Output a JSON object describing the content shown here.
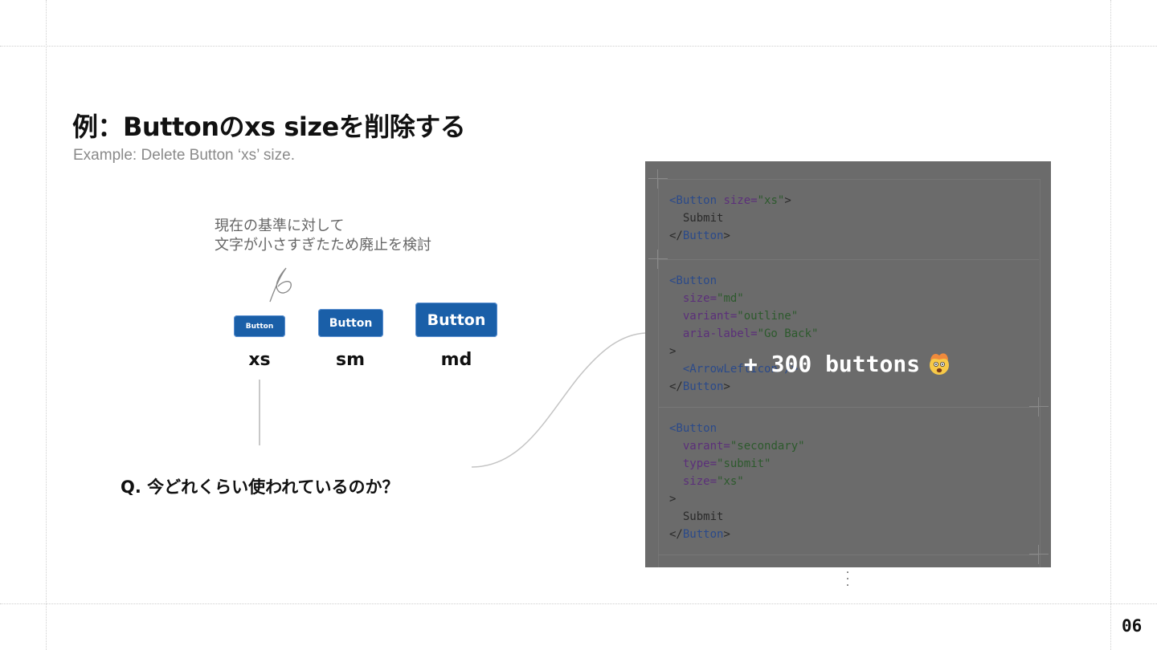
{
  "slide": {
    "title": "例：Buttonのxs sizeを削除する",
    "subtitle": "Example: Delete Button ‘xs’ size.",
    "note_line1": "現在の基準に対して",
    "note_line2": "文字が小さすぎたため廃止を検討",
    "question": "Q. 今どれくらい使われているのか？",
    "page_number": "06"
  },
  "buttons": [
    {
      "size": "xs",
      "label": "Button"
    },
    {
      "size": "sm",
      "label": "Button"
    },
    {
      "size": "md",
      "label": "Button"
    }
  ],
  "code": {
    "block1": {
      "open_tag": "<Button",
      "attr_size": "size=",
      "size_val": "\"xs\"",
      "close_bracket": ">",
      "content": "Submit",
      "end_tag_open": "</",
      "end_tag_name": "Button",
      "end_tag_close": ">"
    },
    "block2": {
      "open_tag": "<Button",
      "attr_size": "size=",
      "size_val": "\"md\"",
      "attr_variant": "variant=",
      "variant_val": "\"outline\"",
      "attr_aria": "aria-label=",
      "aria_val": "\"Go Back\"",
      "close_bracket": ">",
      "child": "<ArrowLeftIcon />",
      "end_tag_open": "</",
      "end_tag_name": "Button",
      "end_tag_close": ">"
    },
    "block3": {
      "open_tag": "<Button",
      "attr_varant": "varant=",
      "varant_val": "\"secondary\"",
      "attr_type": "type=",
      "type_val": "\"submit\"",
      "attr_size": "size=",
      "size_val": "\"xs\"",
      "close_bracket": ">",
      "content": "Submit",
      "end_tag_open": "</",
      "end_tag_name": "Button",
      "end_tag_close": ">"
    },
    "overlay": "+ 300 buttons"
  },
  "icons": {
    "overlay_emoji": "exploding-head-icon",
    "more_indicator": "vertical-ellipsis-icon"
  },
  "colors": {
    "button_bg": "#1a5fa8",
    "panel_bg": "#6b6b6b",
    "text": "#111111",
    "subtitle": "#8a8a8a"
  }
}
